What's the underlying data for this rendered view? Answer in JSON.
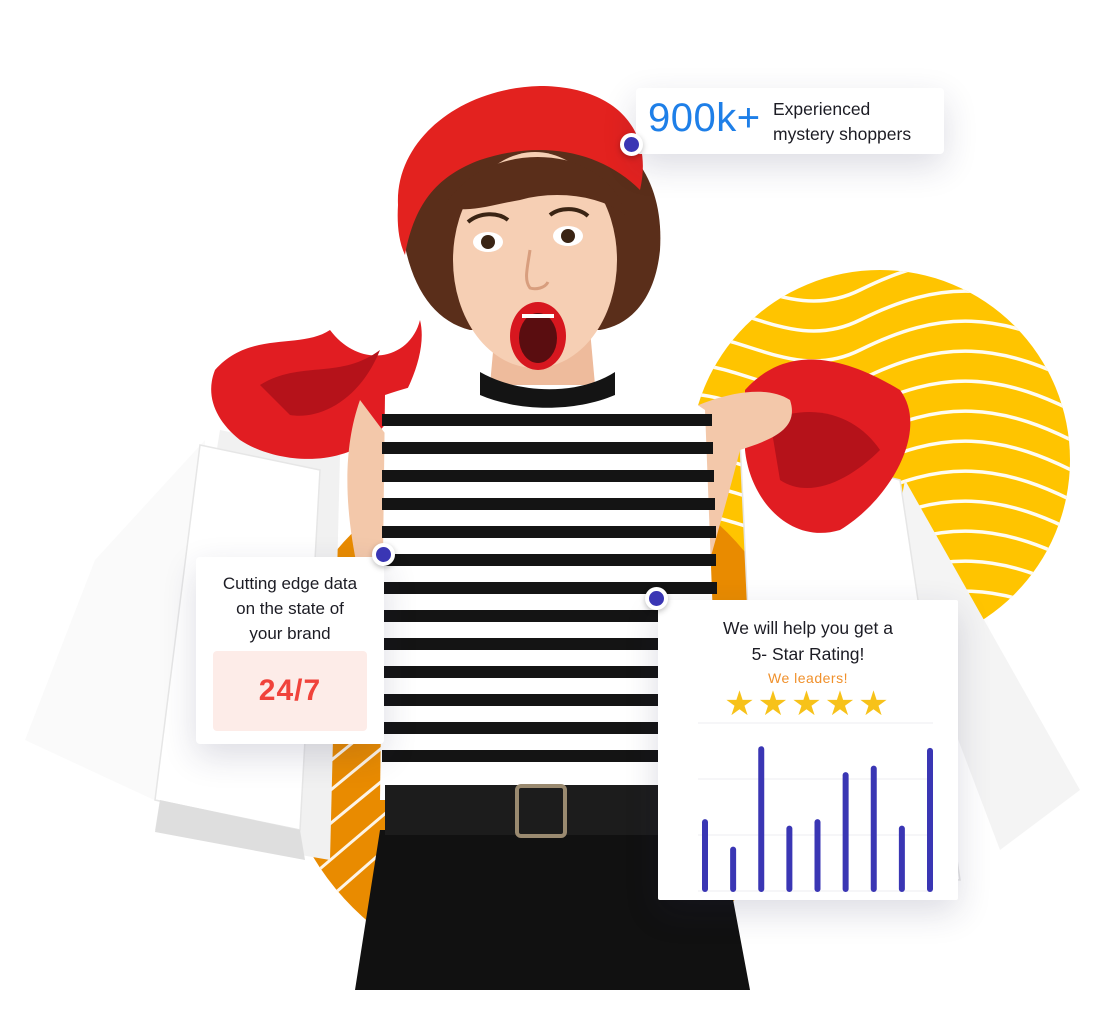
{
  "stat_card": {
    "value": "900k+",
    "label_line1": "Experienced",
    "label_line2": "mystery shoppers"
  },
  "data_card": {
    "text_line1": "Cutting edge data",
    "text_line2": "on the state of",
    "text_line3": "your brand",
    "badge": "24/7"
  },
  "rating_card": {
    "title_line1": "We  will help you get a",
    "title_line2": "5- Star Rating!",
    "tagline": "We  leaders!",
    "stars": "★★★★★",
    "star_count": 5
  },
  "chart_data": {
    "type": "bar",
    "title": "",
    "xlabel": "",
    "ylabel": "",
    "grid": true,
    "values": [
      0.45,
      0.28,
      0.9,
      0.41,
      0.45,
      0.74,
      0.78,
      0.41,
      0.89
    ],
    "ylim": [
      0,
      1
    ]
  },
  "colors": {
    "accent_blue": "#1e7fe8",
    "dot": "#3a36b4",
    "bar": "#3a36b4",
    "badge_text": "#f0433b",
    "badge_bg": "#fdece8",
    "star": "#f7c21a",
    "tagline": "#f0902b",
    "sun_yellow": "#ffc400",
    "sun_orange": "#e98b00"
  }
}
